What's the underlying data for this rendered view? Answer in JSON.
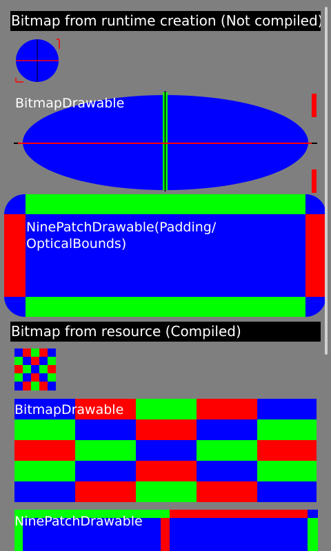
{
  "sections": {
    "runtime": {
      "header": "Bitmap from runtime creation (Not compiled)",
      "bitmap_drawable_label": "BitmapDrawable",
      "ninepatch_label": "NinePatchDrawable(Padding/\nOpticalBounds)"
    },
    "resource": {
      "header": "Bitmap from resource (Compiled)",
      "bitmap_drawable_label": "BitmapDrawable",
      "ninepatch_label": "NinePatchDrawable"
    }
  },
  "colors": {
    "background": "#7f7f7f",
    "blue": "#0000ff",
    "red": "#ff0000",
    "green": "#00ff00",
    "black": "#000000",
    "white": "#ffffff"
  }
}
